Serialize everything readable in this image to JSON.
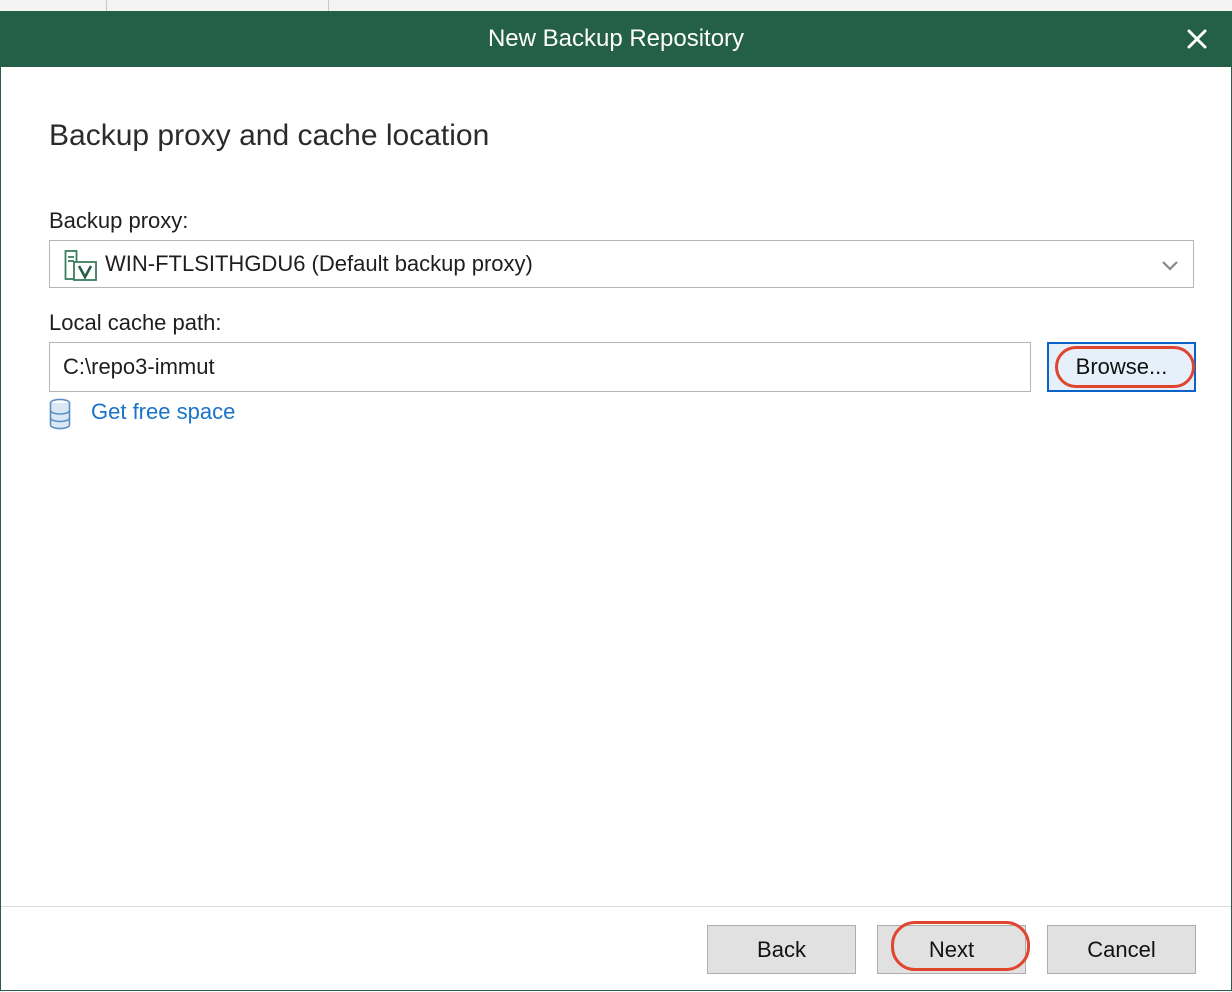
{
  "dialog": {
    "title": "New Backup Repository",
    "close_icon": "close-icon"
  },
  "step": {
    "heading": "Backup proxy and cache location"
  },
  "backup_proxy": {
    "label": "Backup proxy:",
    "icon": "proxy-server-icon",
    "selected_value": "WIN-FTLSITHGDU6 (Default backup proxy)"
  },
  "local_cache": {
    "label": "Local cache path:",
    "value": "C:\\repo3-immut",
    "browse_label": "Browse..."
  },
  "free_space": {
    "icon": "database-icon",
    "link_label": "Get free space"
  },
  "footer": {
    "back_label": "Back",
    "next_label": "Next",
    "cancel_label": "Cancel"
  },
  "colors": {
    "titlebar": "#245f48",
    "link": "#1a73c8",
    "highlight": "#e0452f",
    "focus_border": "#0a64c8"
  }
}
